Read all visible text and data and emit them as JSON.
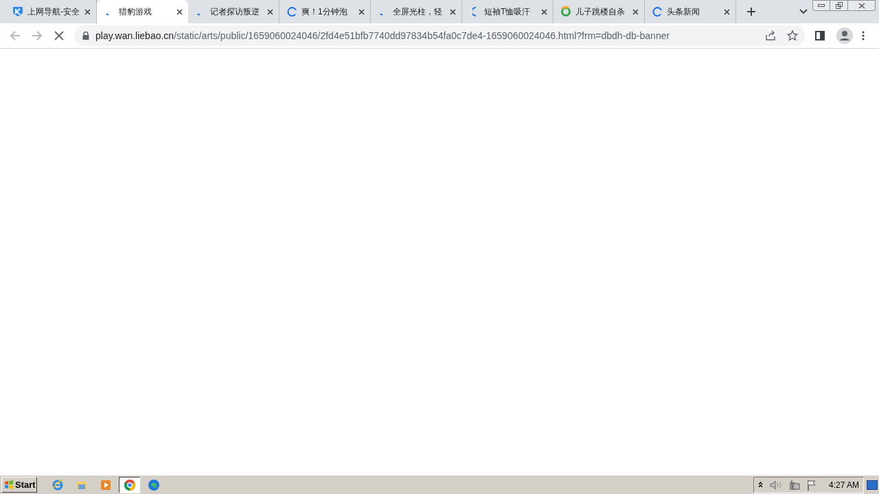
{
  "tabs": [
    {
      "title": "上网导航-安全",
      "selected": false
    },
    {
      "title": "猎豹游戏",
      "selected": true
    },
    {
      "title": "记者探访叛逆",
      "selected": false
    },
    {
      "title": "爽！1分钟泡",
      "selected": false
    },
    {
      "title": "全屏光柱，轻",
      "selected": false
    },
    {
      "title": "短袖T恤吸汗",
      "selected": false
    },
    {
      "title": "儿子跳楼自杀",
      "selected": false
    },
    {
      "title": "头条新闻",
      "selected": false
    }
  ],
  "address_bar": {
    "host": "play.wan.liebao.cn",
    "path": "/static/arts/public/1659060024046/2fd4e51bfb7740dd97834b54fa0c7de4-1659060024046.html?frm=dbdh-db-banner"
  },
  "taskbar": {
    "start": "Start",
    "apps": [
      {
        "selected": false
      },
      {
        "selected": false
      },
      {
        "selected": false
      },
      {
        "selected": true
      },
      {
        "selected": false
      }
    ],
    "clock": "4:27 AM"
  }
}
